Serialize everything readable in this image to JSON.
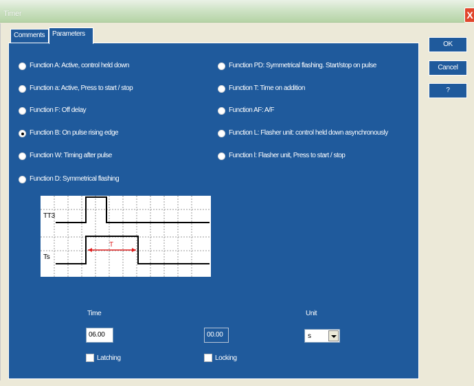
{
  "window": {
    "title": "Timer",
    "close_glyph": "X"
  },
  "tabs": [
    {
      "label": "Comments",
      "active": false
    },
    {
      "label": "Parameters",
      "active": true
    }
  ],
  "functions_left": [
    {
      "label": "Function A: Active, control held down",
      "selected": false
    },
    {
      "label": "Function a: Active, Press to start / stop",
      "selected": false
    },
    {
      "label": "Function F: Off delay",
      "selected": false
    },
    {
      "label": "Function B: On pulse rising edge",
      "selected": true
    },
    {
      "label": "Function W: Timing after pulse",
      "selected": false
    },
    {
      "label": "Function D: Symmetrical flashing",
      "selected": false
    }
  ],
  "functions_right": [
    {
      "label": "Function PD: Symmetrical flashing. Start/stop on pulse",
      "selected": false
    },
    {
      "label": "Function T: Time on addition",
      "selected": false
    },
    {
      "label": "Function AF: A/F",
      "selected": false
    },
    {
      "label": "Function L: Flasher unit: control held down asynchronously",
      "selected": false
    },
    {
      "label": "Function l: Flasher unit, Press to start / stop",
      "selected": false
    }
  ],
  "diagram": {
    "label_top": "TT3",
    "label_bottom": "Ts",
    "arrow_label": "T"
  },
  "time": {
    "label": "Time",
    "value": "06.00",
    "secondary_value": "00.00"
  },
  "unit": {
    "label": "Unit",
    "value": "s"
  },
  "checkboxes": {
    "latching": "Latching",
    "locking": "Locking"
  },
  "buttons": {
    "ok": "OK",
    "cancel": "Cancel",
    "help": "?"
  },
  "colors": {
    "panel": "#1f5a9c",
    "titlebar": "#cfe3c6",
    "close": "#e1462c"
  }
}
